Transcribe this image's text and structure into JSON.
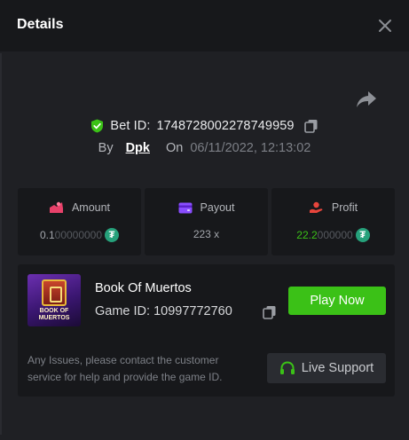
{
  "header": {
    "title": "Details"
  },
  "bet": {
    "id_label": "Bet ID:",
    "id_value": "1748728002278749959",
    "by_label": "By",
    "user": "Dpk",
    "on_label": "On",
    "date": "06/11/2022, 12:13:02"
  },
  "stats": {
    "amount": {
      "label": "Amount",
      "value_main": "0.1",
      "value_dim": "00000000",
      "currency_icon": "usdt-icon"
    },
    "payout": {
      "label": "Payout",
      "value": "223 x"
    },
    "profit": {
      "label": "Profit",
      "value_main": "22.2",
      "value_dim": "000000",
      "currency_icon": "usdt-icon"
    }
  },
  "game": {
    "name": "Book Of Muertos",
    "id_label": "Game ID:",
    "id_value": "10997772760",
    "thumb_text_1": "BOOK OF",
    "thumb_text_2": "MUERTOS",
    "play_label": "Play Now",
    "note": "Any Issues, please contact the customer service for help and provide the game ID.",
    "support_label": "Live Support"
  },
  "colors": {
    "accent_green": "#3bc117",
    "shield_green": "#3bc117",
    "amount_icon": "#e8416a",
    "payout_icon": "#8a4dff",
    "profit_icon": "#e8453c",
    "usdt": "#26a17b"
  }
}
